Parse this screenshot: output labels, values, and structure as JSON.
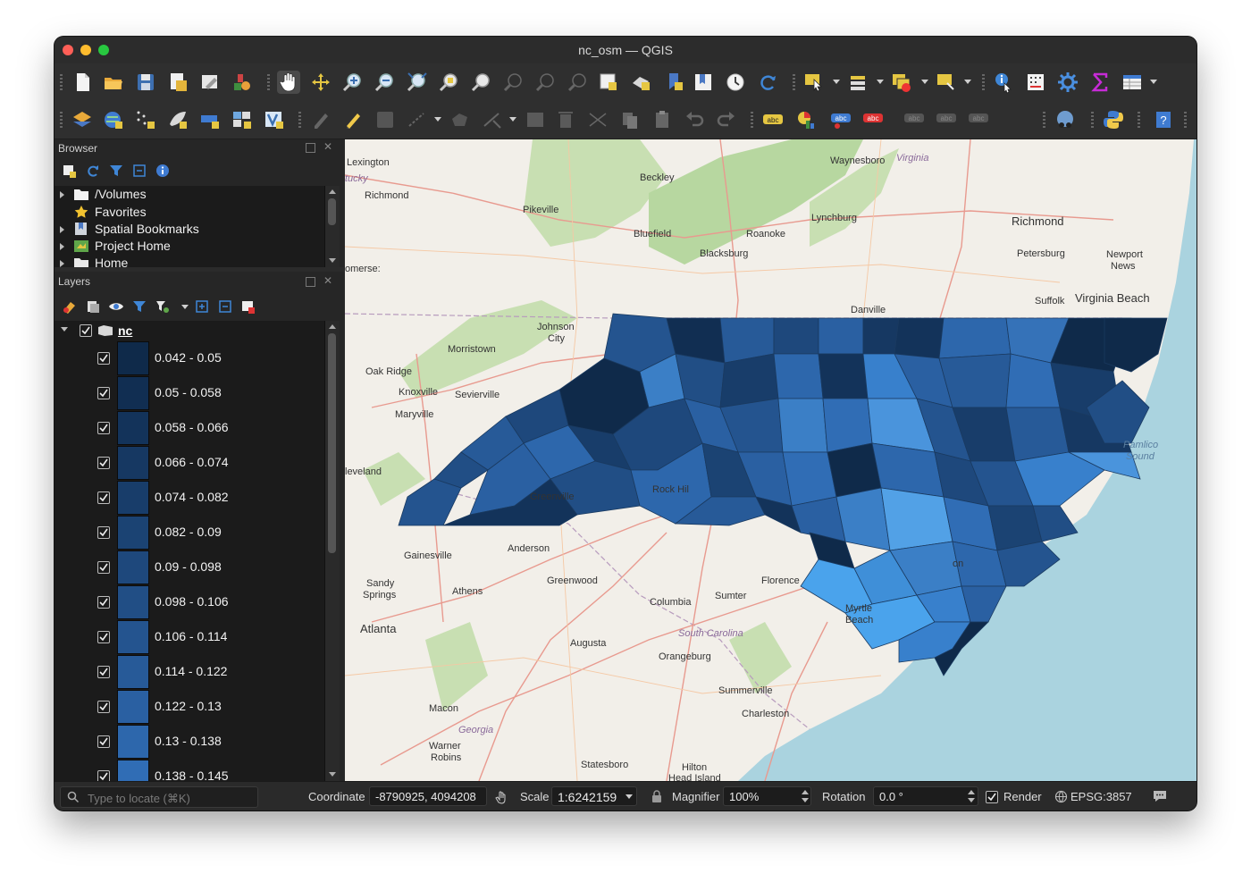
{
  "window": {
    "title": "nc_osm — QGIS"
  },
  "browser": {
    "title": "Browser",
    "items": [
      {
        "label": "/Volumes",
        "icon": "folder-icon"
      },
      {
        "label": "Favorites",
        "icon": "star-icon"
      },
      {
        "label": "Spatial Bookmarks",
        "icon": "bookmark-icon"
      },
      {
        "label": "Project Home",
        "icon": "project-home-icon"
      },
      {
        "label": "Home",
        "icon": "home-folder-icon"
      }
    ]
  },
  "layers": {
    "title": "Layers",
    "layer_name": "nc",
    "classes": [
      {
        "label": "0.042 - 0.05",
        "color": "#0f2a4a"
      },
      {
        "label": "0.05 - 0.058",
        "color": "#112e52"
      },
      {
        "label": "0.058 - 0.066",
        "color": "#13335a"
      },
      {
        "label": "0.066 - 0.074",
        "color": "#163862"
      },
      {
        "label": "0.074 - 0.082",
        "color": "#183d6a"
      },
      {
        "label": "0.082 - 0.09",
        "color": "#1b4373"
      },
      {
        "label": "0.09 - 0.098",
        "color": "#1e487c"
      },
      {
        "label": "0.098 - 0.106",
        "color": "#214e85"
      },
      {
        "label": "0.106 - 0.114",
        "color": "#24548f"
      },
      {
        "label": "0.114 - 0.122",
        "color": "#275a98"
      },
      {
        "label": "0.122 - 0.13",
        "color": "#2a60a2"
      },
      {
        "label": "0.13 - 0.138",
        "color": "#2d67ac"
      },
      {
        "label": "0.138 - 0.145",
        "color": "#306db5"
      }
    ]
  },
  "map": {
    "labels": {
      "lexington": "Lexington",
      "kentucky": "tucky",
      "richmond_ky": "Richmond",
      "pikeville": "Pikeville",
      "beckley": "Beckley",
      "waynesboro": "Waynesboro",
      "virginia": "Virginia",
      "richmond_va": "Richmond",
      "lynchburg": "Lynchburg",
      "bluefield": "Bluefield",
      "roanoke": "Roanoke",
      "blacksburg": "Blacksburg",
      "petersburg": "Petersburg",
      "newport_news": "Newport",
      "newport_news2": "News",
      "suffolk": "Suffolk",
      "virginia_beach": "Virginia Beach",
      "somerset": "omerse:",
      "danville": "Danville",
      "johnson_city": "Johnson",
      "johnson_city2": "City",
      "morristown": "Morristown",
      "oak_ridge": "Oak Ridge",
      "knoxville": "Knoxville",
      "sevierville": "Sevierville",
      "maryville": "Maryville",
      "cleveland": "leveland",
      "greenville": "Greenville",
      "rock_hill": "Rock Hil",
      "anderson": "Anderson",
      "gainesville": "Gainesville",
      "sandy_springs": "Sandy",
      "sandy_springs2": "Springs",
      "athens": "Athens",
      "greenwood": "Greenwood",
      "atlanta": "Atlanta",
      "columbia": "Columbia",
      "sumter": "Sumter",
      "florence": "Florence",
      "myrtle_beach": "Myrtle",
      "myrtle_beach2": "Beach",
      "south_carolina": "South Carolina",
      "augusta": "Augusta",
      "orangeburg": "Orangeburg",
      "summerville": "Summerville",
      "charleston": "Charleston",
      "macon": "Macon",
      "georgia": "Georgia",
      "warner_robins": "Warner",
      "warner_robins2": "Robins",
      "statesboro": "Statesboro",
      "hilton_head": "Hilton",
      "hilton_head2": "Head Island",
      "pamlico": "Pamlico",
      "pamlico2": "Sound",
      "wilmington": "on"
    }
  },
  "status": {
    "locator_placeholder": "Type to locate (⌘K)",
    "coordinate_label": "Coordinate",
    "coordinate_value": "-8790925, 4094208",
    "scale_label": "Scale",
    "scale_value": "1:6242159",
    "magnifier_label": "Magnifier",
    "magnifier_value": "100%",
    "rotation_label": "Rotation",
    "rotation_value": "0.0 °",
    "render_label": "Render",
    "crs": "EPSG:3857"
  }
}
